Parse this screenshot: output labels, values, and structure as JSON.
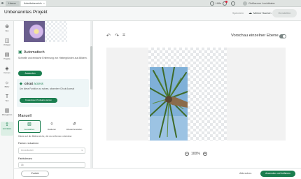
{
  "topbar": {
    "tab_home": "Home",
    "tab_active": "Arbeitsbereich",
    "hilfe": "Hilfe",
    "user_name": "Guillaume Lechthaler"
  },
  "projectbar": {
    "title": "Unbenanntes Projekt",
    "saved_label": "Speichern",
    "share_label": "Meiner Sachen",
    "make_label": "Herstellen"
  },
  "rail": {
    "items": [
      {
        "label": "Neu",
        "icon": "plus-icon"
      },
      {
        "label": "Vorlagen",
        "icon": "template-icon"
      },
      {
        "label": "Projekte",
        "icon": "projects-icon"
      },
      {
        "label": "Formen",
        "icon": "shapes-icon"
      },
      {
        "label": "Bilder",
        "icon": "image-icon"
      },
      {
        "label": "Text",
        "icon": "text-icon"
      },
      {
        "label": "Monogramm",
        "icon": "monogram-icon"
      },
      {
        "label": "Hochladen",
        "icon": "upload-icon"
      }
    ]
  },
  "panel": {
    "auto_title": "Automatisch",
    "auto_desc": "Schnelle und einfache Entfernung von Hintergründen aus Bildern.",
    "apply_label": "Anwenden",
    "access_brand": "cricut",
    "access_word": "access",
    "access_desc": "Um diese Funktion zu nutzen, abonniere Cricut Access!",
    "trial_label": "Kostenlosen Probeabo starten",
    "manual_title": "Manuell",
    "tools": [
      {
        "label": "Auswählen",
        "icon": "select-icon"
      },
      {
        "label": "Radieren",
        "icon": "erase-icon"
      },
      {
        "label": "Wiederherstellen",
        "icon": "restore-icon"
      }
    ],
    "tool_hint": "Klicke auf die Bildbereiche, die du entfernen möchtest.",
    "color_label": "Farben reduzieren",
    "color_placeholder": "Unverändert",
    "tolerance_label": "Farbtoleranz",
    "tolerance_value": "15"
  },
  "canvas": {
    "preview_label": "Vorschau einzelner Ebene",
    "zoom": "100%"
  },
  "bottombar": {
    "back_label": "Zurück",
    "cancel_label": "Abbrechen",
    "apply_close_label": "Anwenden und fortfahren"
  }
}
